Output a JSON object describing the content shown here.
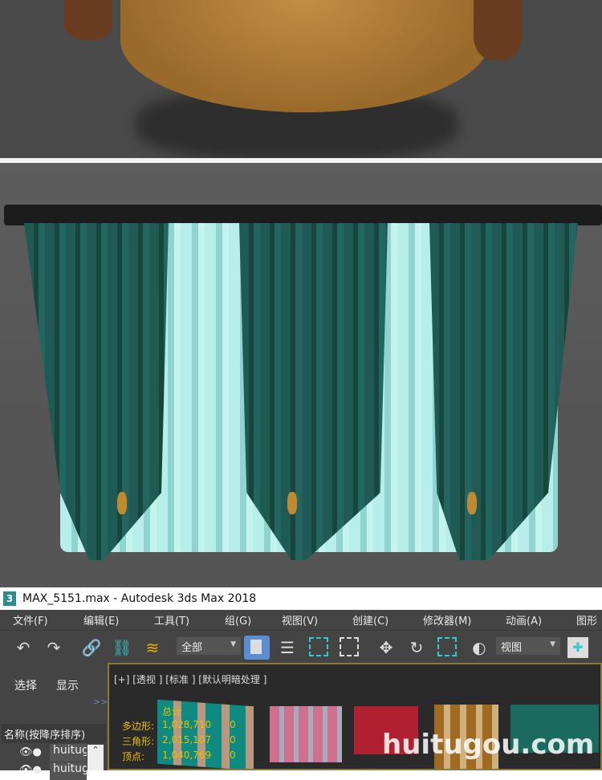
{
  "window": {
    "app_icon": "3",
    "title": "MAX_5151.max - Autodesk 3ds Max 2018"
  },
  "menu": [
    "文件(F)",
    "编辑(E)",
    "工具(T)",
    "组(G)",
    "视图(V)",
    "创建(C)",
    "修改器(M)",
    "动画(A)",
    "图形"
  ],
  "toolbar": {
    "selection_filter": "全部",
    "reference_coord": "视图",
    "icons": [
      "undo-icon",
      "redo-icon",
      "link-icon",
      "unlink-icon",
      "bind-space-warp-icon",
      "select-object-icon",
      "select-by-name-icon",
      "rectangle-selection-icon",
      "window-crossing-icon",
      "move-icon",
      "rotate-icon",
      "scale-icon",
      "placement-icon",
      "pivot-icon"
    ]
  },
  "scene_explorer": {
    "tabs": [
      "选择",
      "显示"
    ],
    "expand": ">>",
    "column_header": "名称(按降序排序)",
    "rows": [
      "huitug",
      "huitug"
    ]
  },
  "viewport": {
    "label": "[+] [透视 ] [标准 ] [默认明暗处理 ]",
    "stats": {
      "header": "总计",
      "rows": [
        {
          "label": "多边形:",
          "total": "1,028,710",
          "sel": "0"
        },
        {
          "label": "三角形:",
          "total": "2,015,107",
          "sel": "0"
        },
        {
          "label": "顶点:",
          "total": "1,040,769",
          "sel": "0"
        }
      ]
    }
  },
  "watermark": "huitugou.com",
  "colors": {
    "teal": "#1f5a55",
    "light_cyan": "#a8e4df",
    "gold": "#c08a30",
    "stats": "#e6c000"
  }
}
